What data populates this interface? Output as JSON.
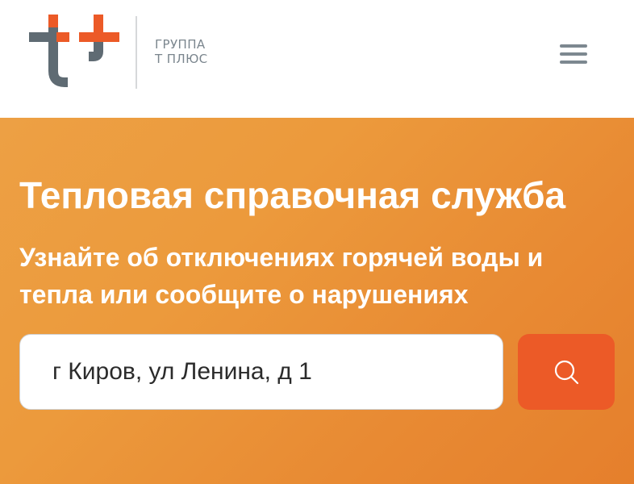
{
  "header": {
    "logo": {
      "icon": "t-plus-logo-icon",
      "text_line1": "ГРУППА",
      "text_line2": "Т ПЛЮС",
      "colors": {
        "primary": "#5f6b73",
        "accent": "#ec5a27"
      }
    },
    "menu": {
      "icon": "hamburger-menu-icon"
    }
  },
  "hero": {
    "title": "Тепловая справочная служба",
    "subtitle": "Узнайте об отключениях горячей воды и тепла или сообщите о нарушениях",
    "background_color": "#ec953a"
  },
  "search": {
    "value": "г Киров, ул Ленина, д 1",
    "button_icon": "search-icon",
    "button_color": "#ec5a27"
  }
}
